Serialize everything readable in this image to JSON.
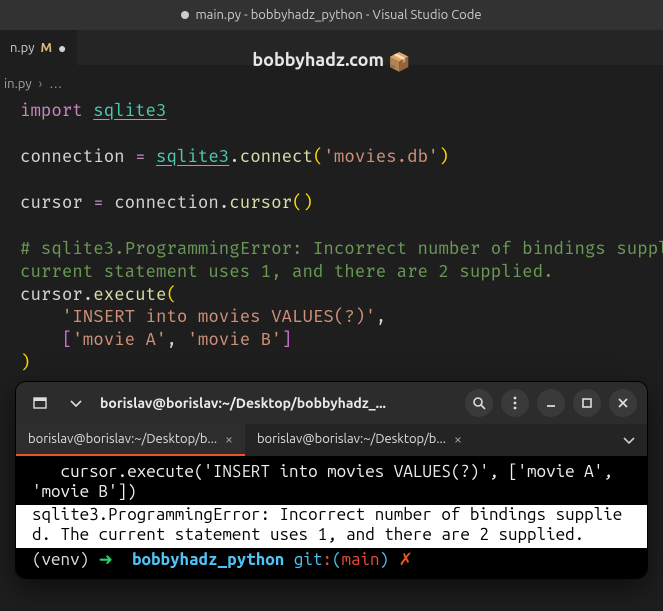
{
  "window": {
    "title": "main.py - bobbyhadz_python - Visual Studio Code"
  },
  "tab": {
    "filename": "n.py",
    "git_status": "M"
  },
  "watermark": {
    "text": "bobbyhadz.com",
    "icon": "📦"
  },
  "breadcrumb": {
    "file": "in.py",
    "sep": "›",
    "rest": "…"
  },
  "code": {
    "l1_kw": "import",
    "l1_mod": "sqlite3",
    "l3_var": "connection",
    "l3_eq": "=",
    "l3_mod": "sqlite3",
    "l3_dot": ".",
    "l3_fn": "connect",
    "l3_lp": "(",
    "l3_str": "'movies.db'",
    "l3_rp": ")",
    "l5_var": "cursor",
    "l5_eq": "=",
    "l5_obj": "connection",
    "l5_dot": ".",
    "l5_fn": "cursor",
    "l5_lp": "(",
    "l5_rp": ")",
    "l7_cmt": "# sqlite3.ProgrammingError: Incorrect number of bindings suppl",
    "l8_cmt": "current statement uses 1, and there are 2 supplied.",
    "l9_obj": "cursor",
    "l9_dot": ".",
    "l9_fn": "execute",
    "l9_lp": "(",
    "l10_str": "'INSERT into movies VALUES(?)'",
    "l10_comma": ",",
    "l11_lb": "[",
    "l11_s1": "'movie A'",
    "l11_comma": ",",
    "l11_s2": "'movie B'",
    "l11_rb": "]",
    "l12_rp": ")"
  },
  "terminal": {
    "title": "borislav@borislav:~/Desktop/bobbyhadz_...",
    "tabs": [
      {
        "label": "borislav@borislav:~/Desktop/b..."
      },
      {
        "label": "borislav@borislav:~/Desktop/b..."
      }
    ],
    "output_line": "   cursor.execute('INSERT into movies VALUES(?)', ['movie A', 'movie B'])",
    "error_text": "sqlite3.ProgrammingError: Incorrect number of bindings supplied. The current statement uses 1, and there are 2 supplied.",
    "prompt": {
      "venv": "(venv)",
      "arrow": "➜",
      "dir": "bobbyhadz_python",
      "git_label": "git",
      "colon": ":",
      "lparen": "(",
      "branch": "main",
      "rparen": ")",
      "cross": "✗"
    }
  }
}
